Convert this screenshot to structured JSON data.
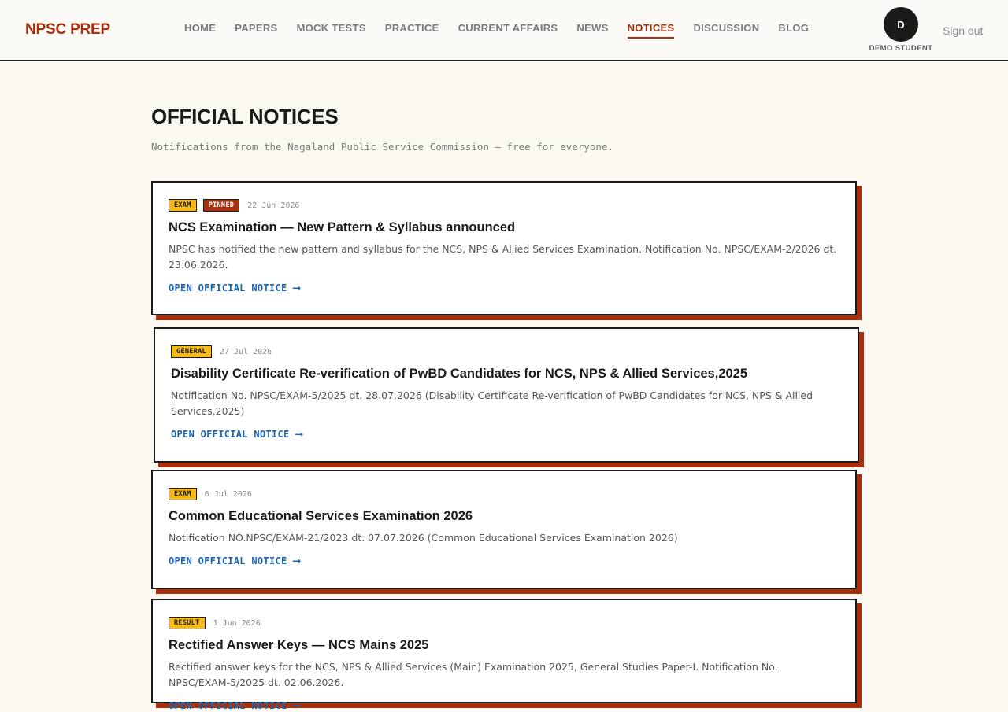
{
  "header": {
    "logo": "NPSC PREP",
    "nav": [
      {
        "label": "HOME",
        "active": false
      },
      {
        "label": "PAPERS",
        "active": false
      },
      {
        "label": "MOCK TESTS",
        "active": false
      },
      {
        "label": "PRACTICE",
        "active": false
      },
      {
        "label": "CURRENT AFFAIRS",
        "active": false
      },
      {
        "label": "NEWS",
        "active": false
      },
      {
        "label": "NOTICES",
        "active": true
      },
      {
        "label": "DISCUSSION",
        "active": false
      },
      {
        "label": "BLOG",
        "active": false
      }
    ],
    "avatar_initial": "D",
    "user_name": "DEMO STUDENT",
    "signout_label": "Sign out"
  },
  "page": {
    "title": "OFFICIAL NOTICES",
    "subtitle": "Notifications from the Nagaland Public Service Commission — free for everyone."
  },
  "notices": [
    {
      "category": "EXAM",
      "pinned": "PINNED",
      "date": "22 Jun 2026",
      "title": "NCS Examination — New Pattern & Syllabus announced",
      "description": "NPSC has notified the new pattern and syllabus for the NCS, NPS & Allied Services Examination. Notification No. NPSC/EXAM-2/2026 dt. 23.06.2026.",
      "link": "OPEN OFFICIAL NOTICE"
    },
    {
      "category": "GENERAL",
      "pinned": "",
      "date": "27 Jul 2026",
      "title": "Disability Certificate Re-verification of PwBD Candidates for NCS, NPS & Allied Services,2025",
      "description": "Notification No. NPSC/EXAM-5/2025 dt. 28.07.2026 (Disability Certificate Re-verification of PwBD Candidates for NCS, NPS & Allied Services,2025)",
      "link": "OPEN OFFICIAL NOTICE"
    },
    {
      "category": "EXAM",
      "pinned": "",
      "date": "6 Jul 2026",
      "title": "Common Educational Services Examination 2026",
      "description": "Notification NO.NPSC/EXAM-21/2023 dt. 07.07.2026 (Common Educational Services Examination 2026)",
      "link": "OPEN OFFICIAL NOTICE"
    },
    {
      "category": "RESULT",
      "pinned": "",
      "date": "1 Jun 2026",
      "title": "Rectified Answer Keys — NCS Mains 2025",
      "description": "Rectified answer keys for the NCS, NPS & Allied Services (Main) Examination 2025, General Studies Paper-I. Notification No. NPSC/EXAM-5/2025 dt. 02.06.2026.",
      "link": "OPEN OFFICIAL NOTICE"
    }
  ],
  "colors": {
    "brand": "#a8300c",
    "badge_yellow": "#f5b918",
    "link_blue": "#1a66b5",
    "background": "#fbf8f2"
  }
}
